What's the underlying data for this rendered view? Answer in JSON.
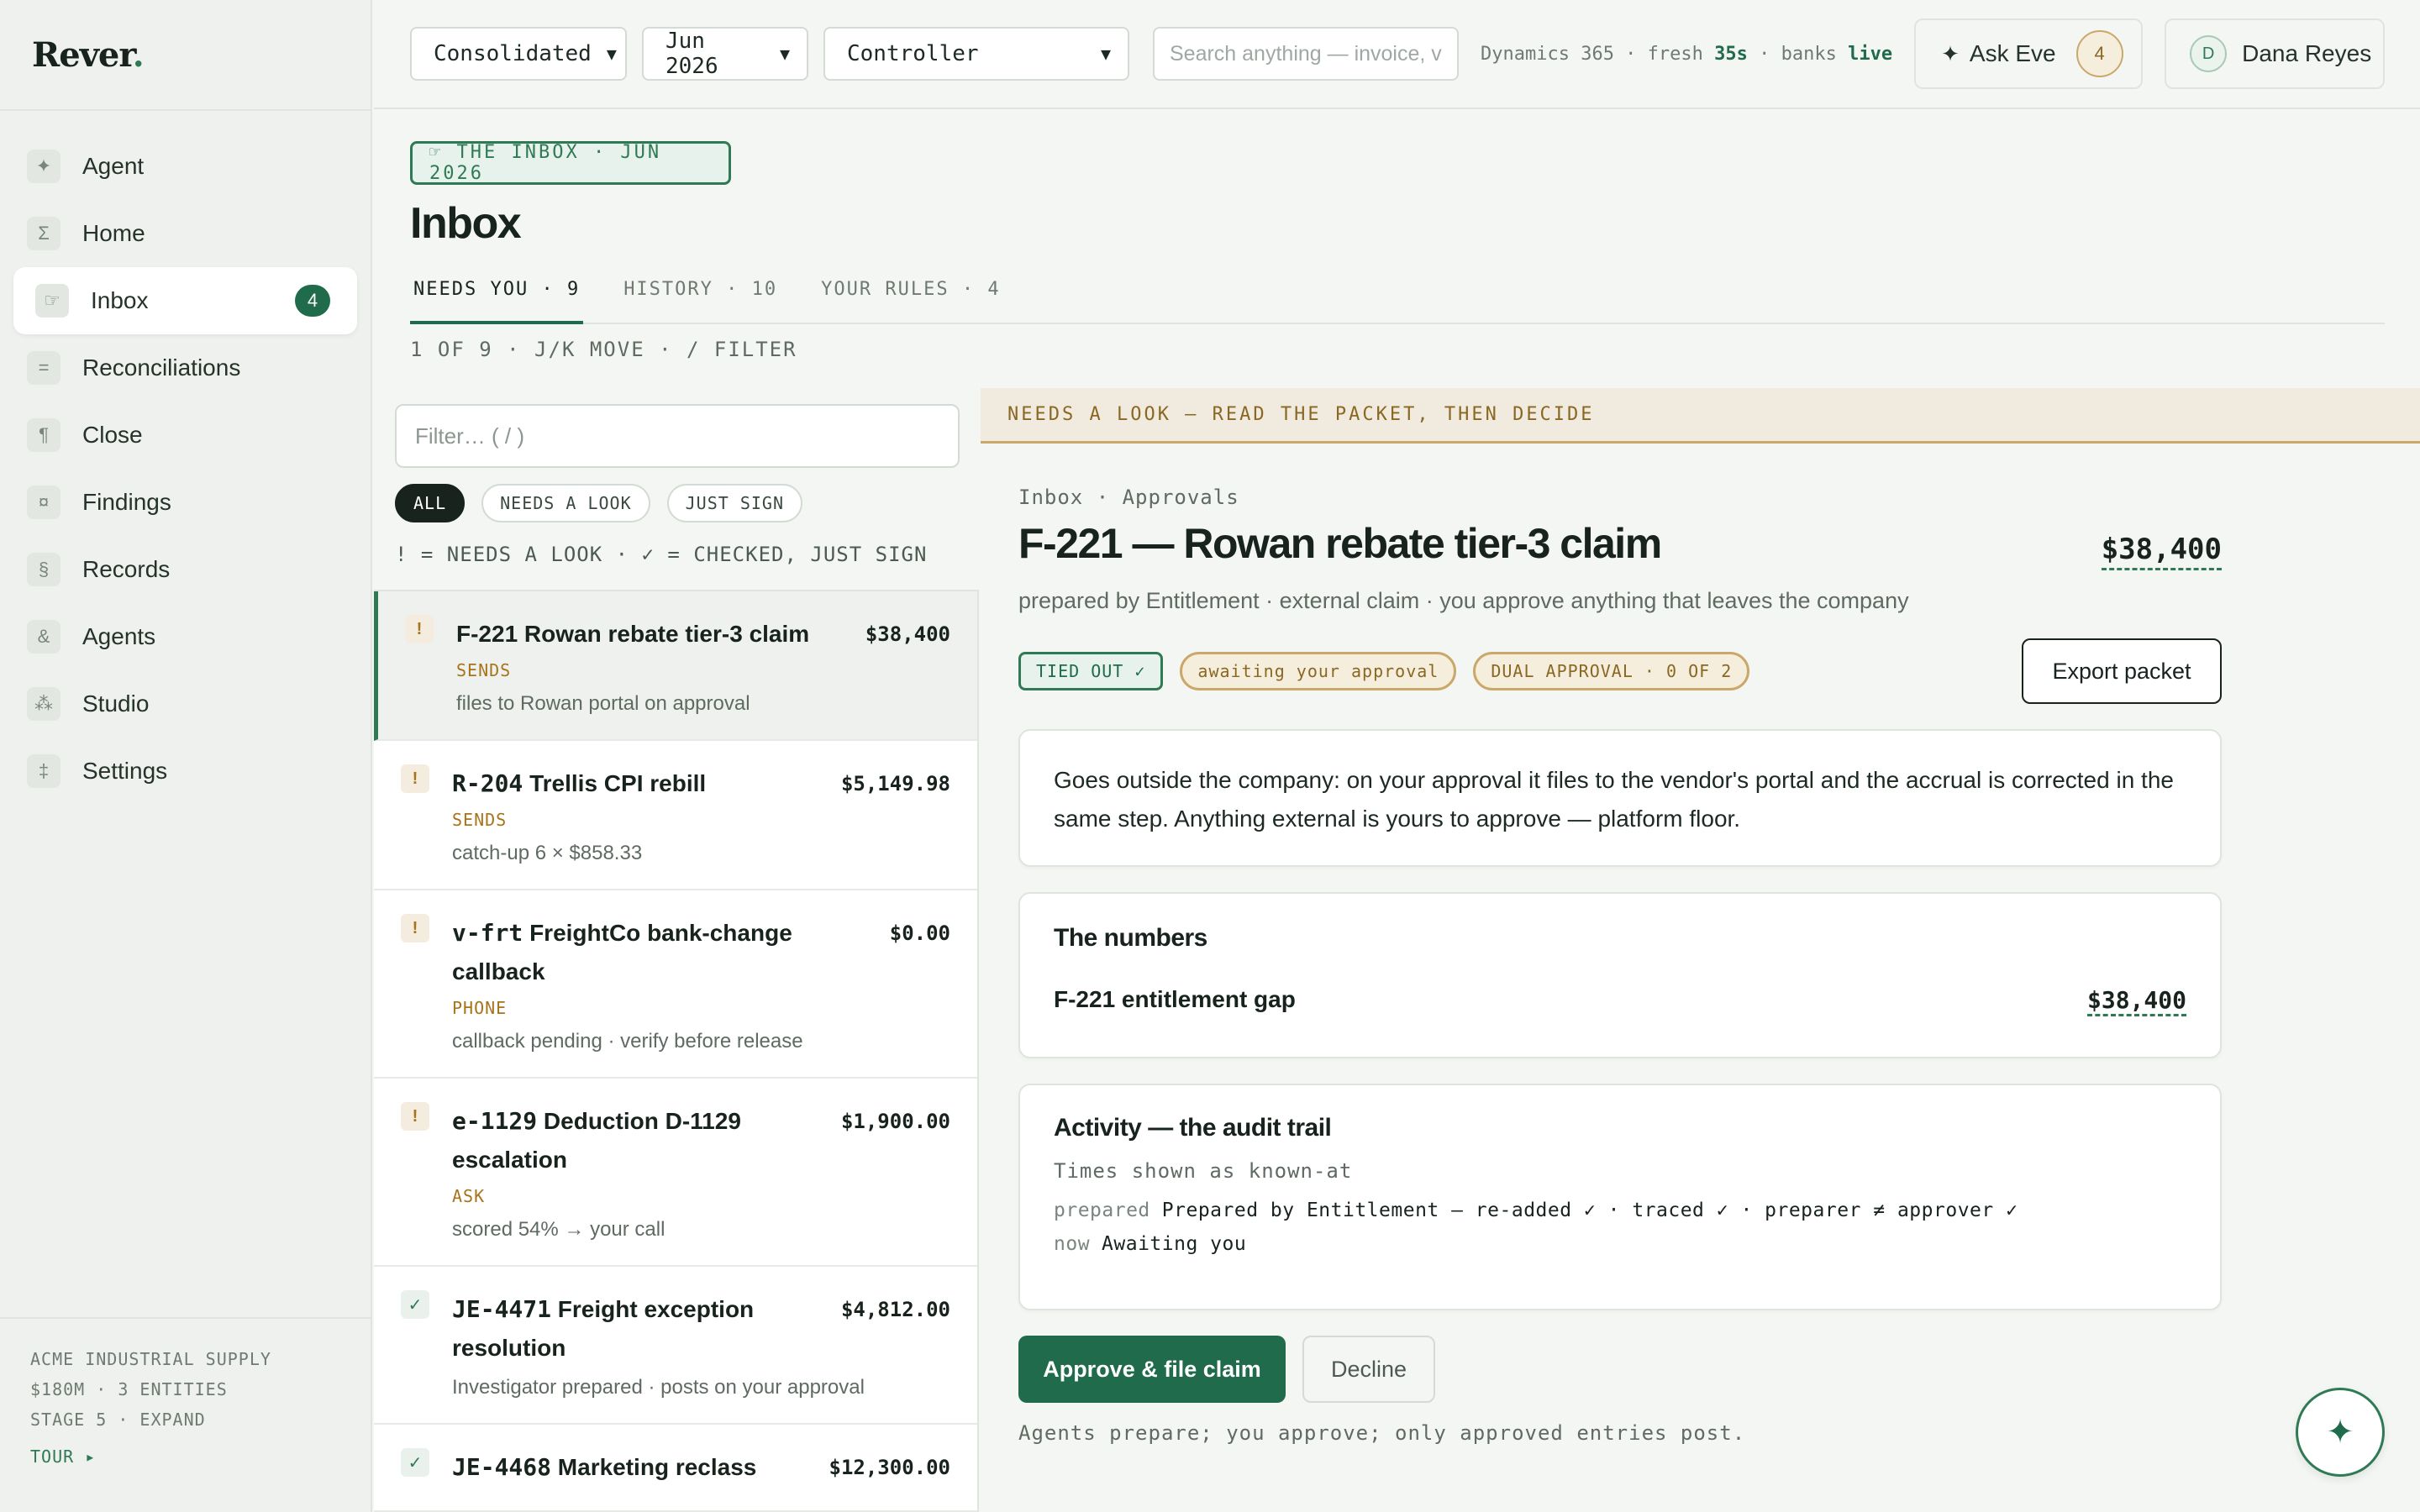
{
  "app": {
    "logo": "Rever",
    "logo_dot": "."
  },
  "sidebar": {
    "items": [
      {
        "label": "Agent",
        "glyph": "✦",
        "icon": "agent-icon"
      },
      {
        "label": "Home",
        "glyph": "Σ",
        "icon": "sigma-icon"
      },
      {
        "label": "Inbox",
        "glyph": "☞",
        "icon": "pointing-hand-icon",
        "badge": "4"
      },
      {
        "label": "Reconciliations",
        "glyph": "=",
        "icon": "equals-icon"
      },
      {
        "label": "Close",
        "glyph": "¶",
        "icon": "pilcrow-icon"
      },
      {
        "label": "Findings",
        "glyph": "¤",
        "icon": "findings-icon"
      },
      {
        "label": "Records",
        "glyph": "§",
        "icon": "section-icon"
      },
      {
        "label": "Agents",
        "glyph": "&",
        "icon": "ampersand-icon"
      },
      {
        "label": "Studio",
        "glyph": "⁂",
        "icon": "asterism-icon"
      },
      {
        "label": "Settings",
        "glyph": "‡",
        "icon": "double-dagger-icon"
      }
    ],
    "footer": {
      "company": "ACME INDUSTRIAL SUPPLY",
      "scale": "$180M · 3 ENTITIES",
      "stage": "STAGE 5 · EXPAND",
      "tour": "TOUR ▸"
    }
  },
  "topbar": {
    "entity": "Consolidated",
    "period": "Jun 2026",
    "role": "Controller",
    "search_placeholder": "Search anything — invoice, v",
    "status_source": "Dynamics 365 · fresh ",
    "status_fresh": "35s",
    "status_mid": " · banks ",
    "status_live": "live",
    "ask_label": "Ask Eve",
    "ask_count": "4",
    "user_initial": "D",
    "user_name": "Dana Reyes"
  },
  "page": {
    "chip": "☞ THE INBOX · JUN 2026",
    "title": "Inbox",
    "tabs": [
      {
        "label": "NEEDS YOU · 9"
      },
      {
        "label": "HISTORY · 10"
      },
      {
        "label": "YOUR RULES · 4"
      }
    ],
    "hint": "1 OF 9 · J/K MOVE · / FILTER"
  },
  "list": {
    "filter_placeholder": "Filter… ( / )",
    "chips": [
      "ALL",
      "NEEDS A LOOK",
      "JUST SIGN"
    ],
    "legend": "! = NEEDS A LOOK · ✓ = CHECKED, JUST SIGN",
    "items": [
      {
        "mark": "!",
        "kind": "look",
        "title_code": "F-221",
        "title_text": " Rowan rebate tier-3 claim",
        "amount": "$38,400",
        "tag": "SENDS",
        "sub": "files to Rowan portal on approval"
      },
      {
        "mark": "!",
        "kind": "look",
        "title_code": "R-204",
        "title_text": " Trellis CPI rebill",
        "amount": "$5,149.98",
        "tag": "SENDS",
        "sub": "catch-up 6 × $858.33"
      },
      {
        "mark": "!",
        "kind": "look",
        "title_code": "v-frt",
        "title_text": " FreightCo bank-change callback",
        "amount": "$0.00",
        "tag": "PHONE",
        "sub": "callback pending · verify before release"
      },
      {
        "mark": "!",
        "kind": "look",
        "title_code": "e-1129",
        "title_text": " Deduction D-1129 escalation",
        "amount": "$1,900.00",
        "tag": "ASK",
        "sub": "scored 54% → your call"
      },
      {
        "mark": "✓",
        "kind": "sign",
        "title_code": "JE-4471",
        "title_text": " Freight exception resolution",
        "amount": "$4,812.00",
        "tag": "",
        "sub": "Investigator prepared · posts on your approval"
      },
      {
        "mark": "✓",
        "kind": "sign",
        "title_code": "JE-4468",
        "title_text": " Marketing reclass",
        "amount": "$12,300.00",
        "tag": "",
        "sub": ""
      }
    ]
  },
  "detail": {
    "banner": "NEEDS A LOOK — READ THE PACKET, THEN DECIDE",
    "crumb": "Inbox · Approvals",
    "title": "F-221 — Rowan rebate tier-3 claim",
    "amount": "$38,400",
    "subtitle": "prepared by Entitlement · external claim · you approve anything that leaves the company",
    "pills": {
      "tied": "TIED OUT ✓",
      "awaiting": "awaiting your approval",
      "dual": "DUAL APPROVAL · 0 OF 2"
    },
    "export_label": "Export packet",
    "note": "Goes outside the company: on your approval it files to the vendor's portal and the accrual is corrected in the same step. Anything external is yours to approve — platform floor.",
    "numbers": {
      "heading": "The numbers",
      "label": "F-221 entitlement gap",
      "value": "$38,400"
    },
    "activity": {
      "heading": "Activity — the audit trail",
      "known_at": "Times shown as known-at",
      "line1_when": "prepared",
      "line1_text": "Prepared by Entitlement — re-added ✓ · traced ✓ · preparer ≠ approver ✓",
      "line2_when": "now",
      "line2_text": "Awaiting you"
    },
    "approve_label": "Approve & file claim",
    "decline_label": "Decline",
    "footnote": "Agents prepare; you approve; only approved entries post."
  },
  "fab_glyph": "✦",
  "colors": {
    "accent": "#1f6b4b",
    "amber": "#a8741a",
    "background": "#f4f6f3"
  }
}
